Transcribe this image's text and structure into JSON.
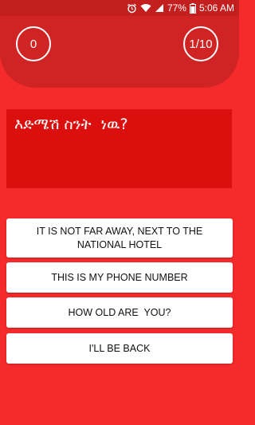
{
  "status_bar": {
    "battery_percent": "77%",
    "time": "5:06 AM",
    "icons": [
      "alarm-icon",
      "wifi-icon",
      "signal-icon",
      "battery-icon"
    ]
  },
  "score": "0",
  "progress": "1/10",
  "question": "እድሜሽ ስንት  ነዉ?",
  "answers": [
    "IT IS NOT FAR AWAY, NEXT TO THE NATIONAL HOTEL",
    "THIS IS MY PHONE NUMBER",
    "HOW OLD ARE  YOU?",
    "I'LL BE BACK"
  ],
  "colors": {
    "background": "#f52b2b",
    "header_panel": "#d02424",
    "status_bar": "#c41f1f",
    "question_box": "#dc0f0f",
    "answer_button": "#ffffff"
  }
}
